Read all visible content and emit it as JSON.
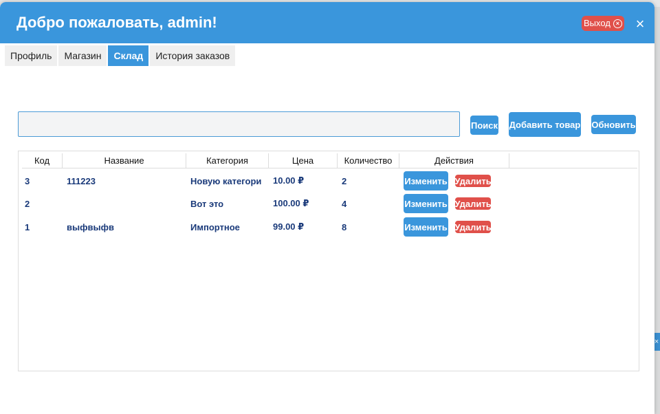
{
  "window": {
    "title": "Добро пожаловать, admin!",
    "logout_label": "Выход",
    "close_glyph": "×"
  },
  "tabs": [
    {
      "label": "Профиль",
      "active": false
    },
    {
      "label": "Магазин",
      "active": false
    },
    {
      "label": "Склад",
      "active": true
    },
    {
      "label": "История заказов",
      "active": false
    }
  ],
  "toolbar": {
    "search_value": "",
    "search_label": "Поиск",
    "add_label": "Добавить товар",
    "refresh_label": "Обновить"
  },
  "table": {
    "headers": [
      "Код",
      "Название",
      "Категория",
      "Цена",
      "Количество",
      "Действия"
    ],
    "rows": [
      {
        "code": "3",
        "name": "111223",
        "category": "Новую категори",
        "price": "10.00 ₽",
        "qty": "2"
      },
      {
        "code": "2",
        "name": "",
        "category": "Вот это",
        "price": "100.00 ₽",
        "qty": "4"
      },
      {
        "code": "1",
        "name": "выфвыфв",
        "category": "Импортное",
        "price": "99.00 ₽",
        "qty": "8"
      }
    ],
    "edit_label": "Изменить",
    "delete_label": "Удалить"
  },
  "colors": {
    "accent": "#3a96dc",
    "danger": "#e0504a",
    "cell_text": "#1a3a7a"
  }
}
